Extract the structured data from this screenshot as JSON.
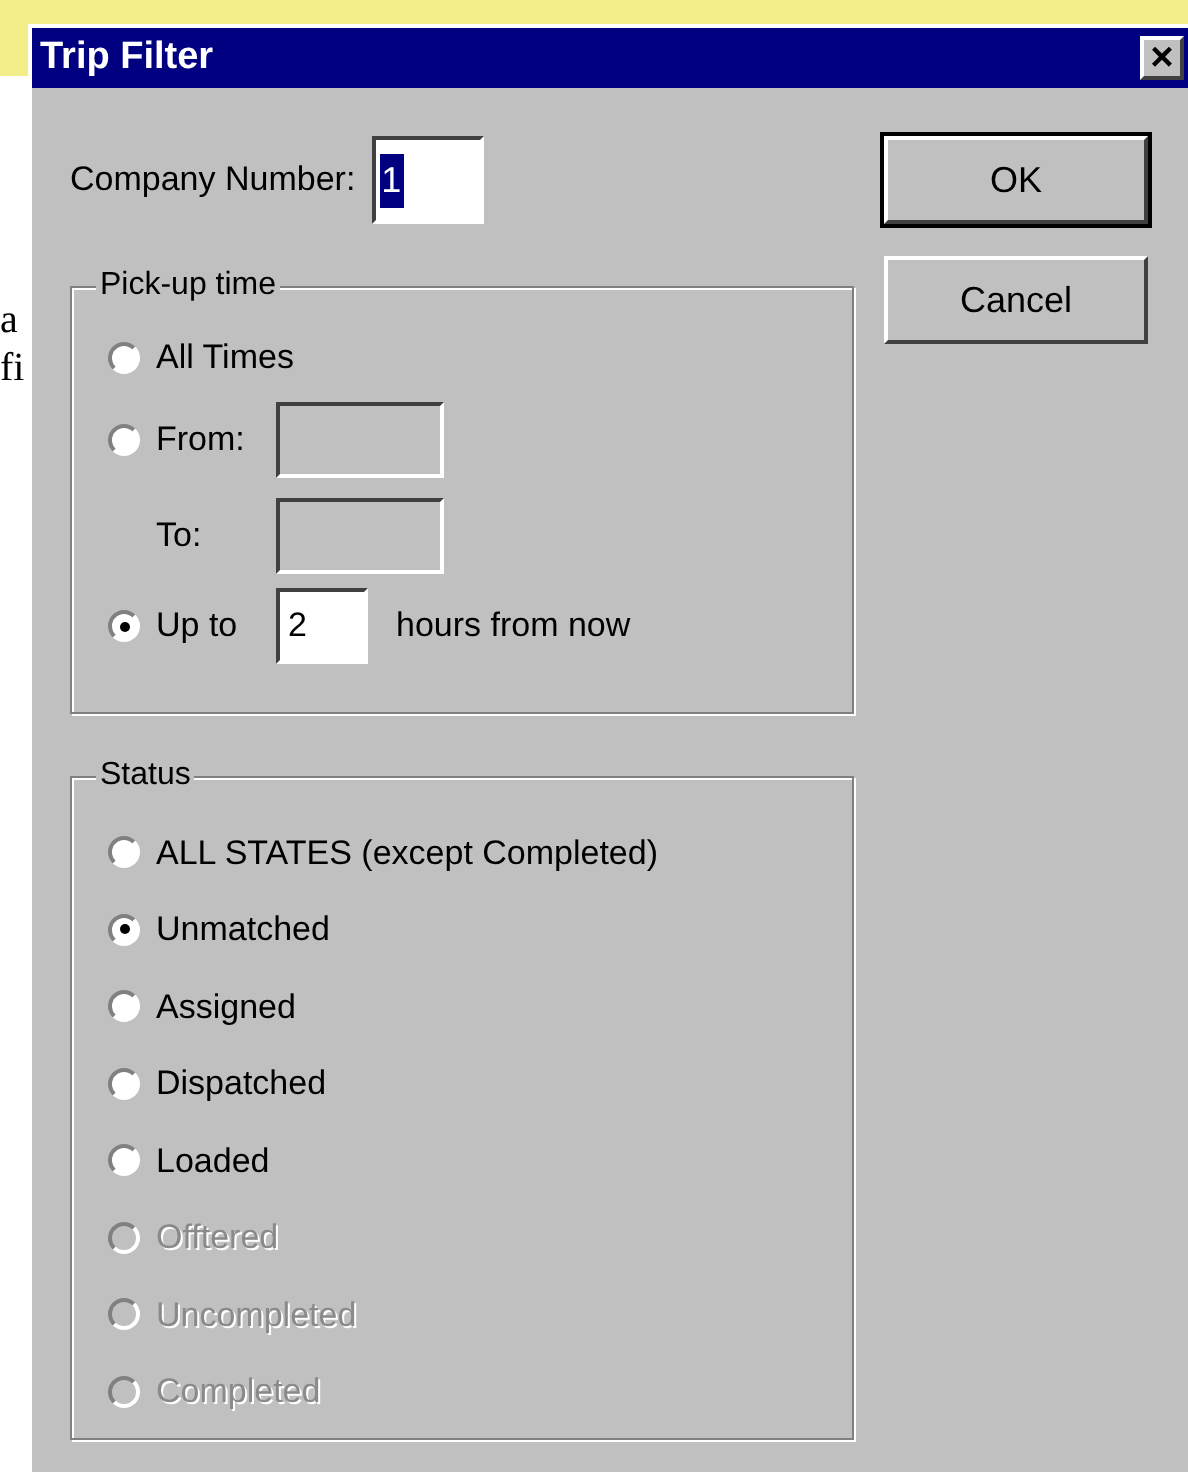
{
  "background_text": [
    "a",
    "fi"
  ],
  "window": {
    "title": "Trip Filter",
    "close": "×"
  },
  "company_number": {
    "label": "Company Number:",
    "value": "1"
  },
  "buttons": [
    {
      "label": "OK",
      "default": true
    },
    {
      "label": "Cancel",
      "default": false
    }
  ],
  "pickup": {
    "title": "Pick-up time",
    "options": [
      {
        "kind": "plain",
        "label": "All Times",
        "selected": false
      },
      {
        "kind": "range",
        "label": "From:",
        "selected": false,
        "to_label": "To:"
      },
      {
        "kind": "hours",
        "label": "Up to",
        "selected": true,
        "value": "2",
        "suffix": "hours from now"
      }
    ]
  },
  "status": {
    "title": "Status",
    "options": [
      {
        "label": "ALL STATES (except Completed)",
        "selected": false,
        "disabled": false
      },
      {
        "label": "Unmatched",
        "selected": true,
        "disabled": false
      },
      {
        "label": "Assigned",
        "selected": false,
        "disabled": false
      },
      {
        "label": "Dispatched",
        "selected": false,
        "disabled": false
      },
      {
        "label": "Loaded",
        "selected": false,
        "disabled": false
      },
      {
        "label": "Offtered",
        "selected": false,
        "disabled": true
      },
      {
        "label": "Uncompleted",
        "selected": false,
        "disabled": true
      },
      {
        "label": "Completed",
        "selected": false,
        "disabled": true
      }
    ]
  }
}
